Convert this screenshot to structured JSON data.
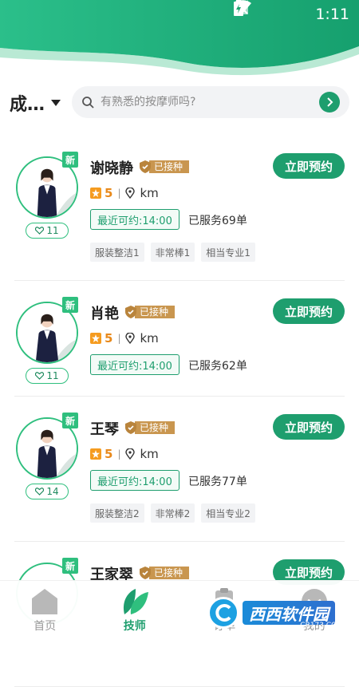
{
  "status_bar": {
    "time": "1:11"
  },
  "location": {
    "city": "成…"
  },
  "search": {
    "placeholder": "有熟悉的按摩师吗?"
  },
  "colors": {
    "primary": "#1e9e6e",
    "accent_green": "#2fbf7e",
    "cert_gold": "#c9964f",
    "star_orange": "#f59b1f"
  },
  "therapists": [
    {
      "name": "谢晓静",
      "new_badge": "新",
      "cert_label": "已接种",
      "book_label": "立即预约",
      "rating": "5",
      "distance_unit": "km",
      "next_available": "最近可约:14:00",
      "served": "已服务69单",
      "likes": "11",
      "tags": [
        "服装整洁1",
        "非常棒1",
        "相当专业1"
      ]
    },
    {
      "name": "肖艳",
      "new_badge": "新",
      "cert_label": "已接种",
      "book_label": "立即预约",
      "rating": "5",
      "distance_unit": "km",
      "next_available": "最近可约:14:00",
      "served": "已服务62单",
      "likes": "11",
      "tags": []
    },
    {
      "name": "王琴",
      "new_badge": "新",
      "cert_label": "已接种",
      "book_label": "立即预约",
      "rating": "5",
      "distance_unit": "km",
      "next_available": "最近可约:14:00",
      "served": "已服务77单",
      "likes": "14",
      "tags": [
        "服装整洁2",
        "非常棒2",
        "相当专业2"
      ]
    },
    {
      "name": "王家翠",
      "new_badge": "新",
      "cert_label": "已接种",
      "book_label": "立即预约"
    }
  ],
  "nav": [
    {
      "label": "首页",
      "icon": "home-icon",
      "active": false
    },
    {
      "label": "技师",
      "icon": "leaf-icon",
      "active": true
    },
    {
      "label": "订单",
      "icon": "order-icon",
      "active": false
    },
    {
      "label": "我的",
      "icon": "profile-icon",
      "active": false
    }
  ],
  "watermark": {
    "text": "西西软件园",
    "sub": "CR173.COM"
  }
}
